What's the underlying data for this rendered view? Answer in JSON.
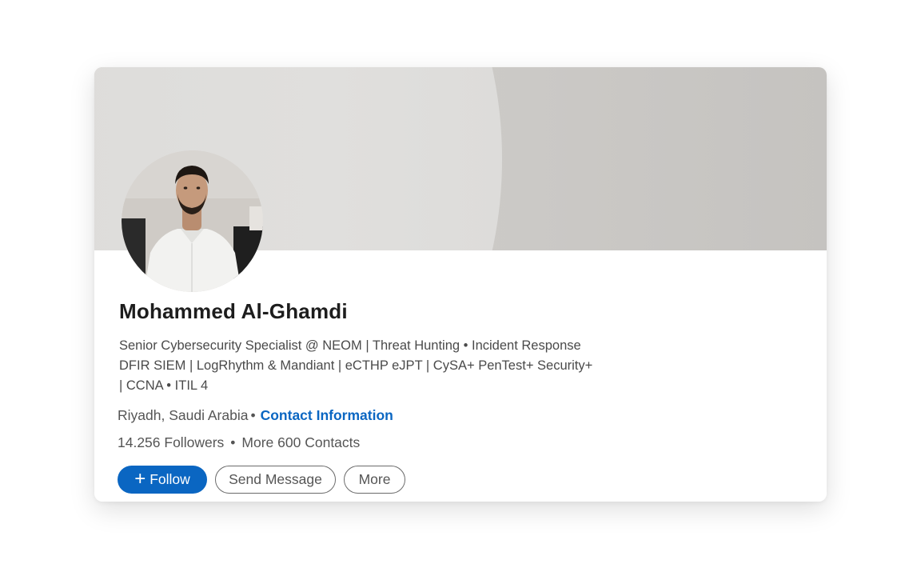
{
  "profile": {
    "name": "Mohammed Al-Ghamdi",
    "headline_lines": [
      "Senior Cybersecurity Specialist @ NEOM | Threat Hunting • Incident Response",
      "DFIR  SIEM | LogRhythm & Mandiant | eCTHP  eJPT | CySA+  PenTest+  Security+",
      "| CCNA • ITIL 4"
    ],
    "location": "Riyadh, Saudi Arabia",
    "contact_link": "Contact Information",
    "followers": "14.256 Followers",
    "contacts": "More 600 Contacts"
  },
  "actions": {
    "follow_label": "Follow",
    "message_label": "Send Message",
    "more_label": "More"
  },
  "icons": {
    "separator": "•",
    "plus": "+"
  },
  "colors": {
    "accent": "#0a66c2",
    "text_primary": "#1d1d1d",
    "text_secondary": "#555555"
  }
}
